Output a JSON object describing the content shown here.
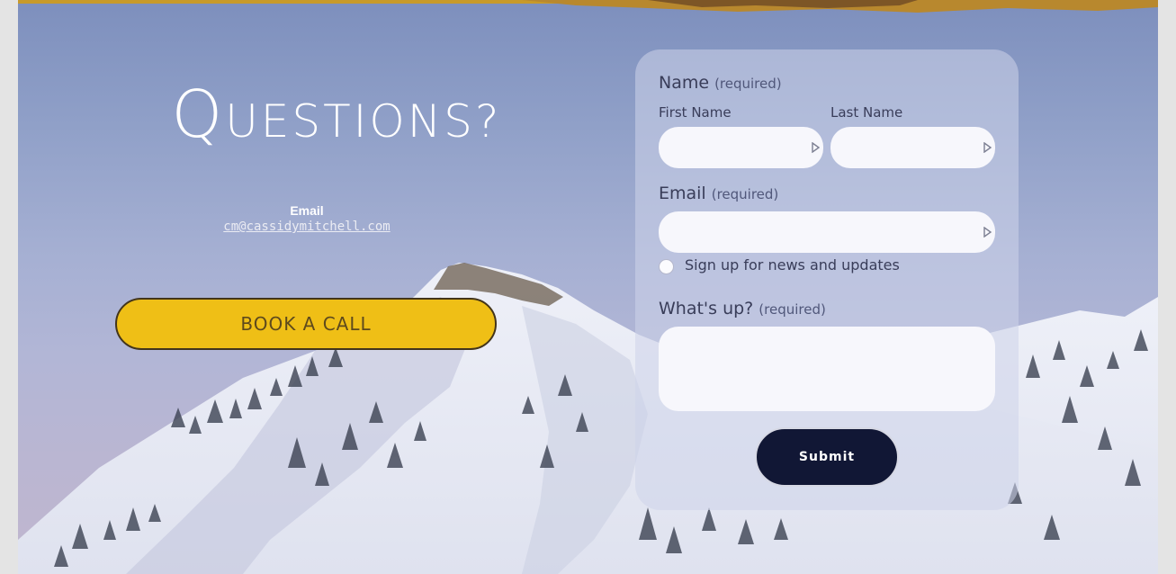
{
  "hero": {
    "heading_first": "Q",
    "heading_rest": "UESTIONS?"
  },
  "contact": {
    "email_label": "Email",
    "email_address": "cm@cassidymitchell.com"
  },
  "book_call_label": "BOOK A CALL",
  "form": {
    "name_label": "Name",
    "name_required": "(required)",
    "first_name_label": "First Name",
    "last_name_label": "Last Name",
    "first_name_value": "",
    "last_name_value": "",
    "email_label": "Email",
    "email_required": "(required)",
    "email_value": "",
    "newsletter_label": "Sign up for news and updates",
    "message_label": "What's up?",
    "message_required": "(required)",
    "message_value": "",
    "submit_label": "Submit"
  },
  "colors": {
    "book_button": "#efbf16",
    "submit_button": "#111735",
    "label_text": "#393d59"
  },
  "icons": {
    "field_autofill": "autofill-arrow-icon"
  }
}
